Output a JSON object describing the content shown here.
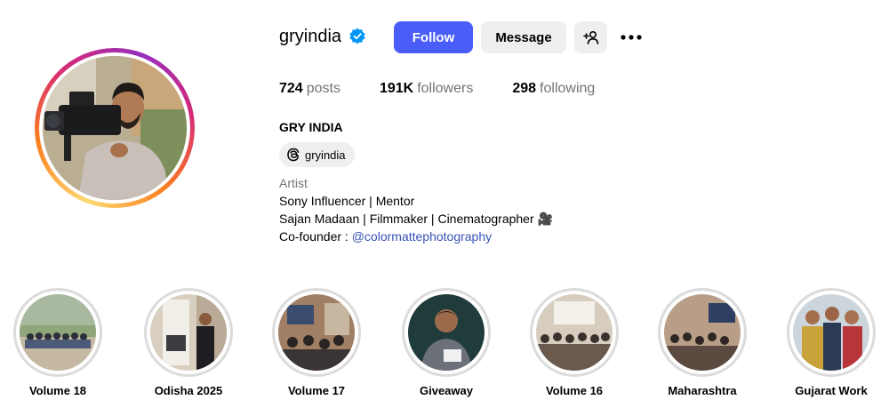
{
  "profile": {
    "username": "gryindia",
    "verified_icon": "verified-badge-icon",
    "follow_label": "Follow",
    "message_label": "Message",
    "add_user_icon": "add-user-icon",
    "more_icon": "more-options-icon",
    "full_name": "GRY INDIA",
    "threads_handle": "gryindia"
  },
  "stats": {
    "posts_count": "724",
    "posts_label": "posts",
    "followers_count": "191K",
    "followers_label": "followers",
    "following_count": "298",
    "following_label": "following"
  },
  "bio": {
    "category": "Artist",
    "line1": "Sony Influencer | Mentor",
    "line2": "Sajan Madaan | Filmmaker | Cinematographer 🎥",
    "line3_prefix": "Co-founder : ",
    "line3_link": "@colormattephotography"
  },
  "highlights": [
    {
      "label": "Volume 18"
    },
    {
      "label": "Odisha 2025"
    },
    {
      "label": "Volume 17"
    },
    {
      "label": "Giveaway"
    },
    {
      "label": "Volume 16"
    },
    {
      "label": "Maharashtra"
    },
    {
      "label": "Gujarat Work"
    }
  ],
  "colors": {
    "follow_button": "#4a5df9",
    "secondary_button": "#efefef",
    "verified_badge": "#0095f6",
    "link": "#3952b8",
    "muted_text": "#737373"
  }
}
